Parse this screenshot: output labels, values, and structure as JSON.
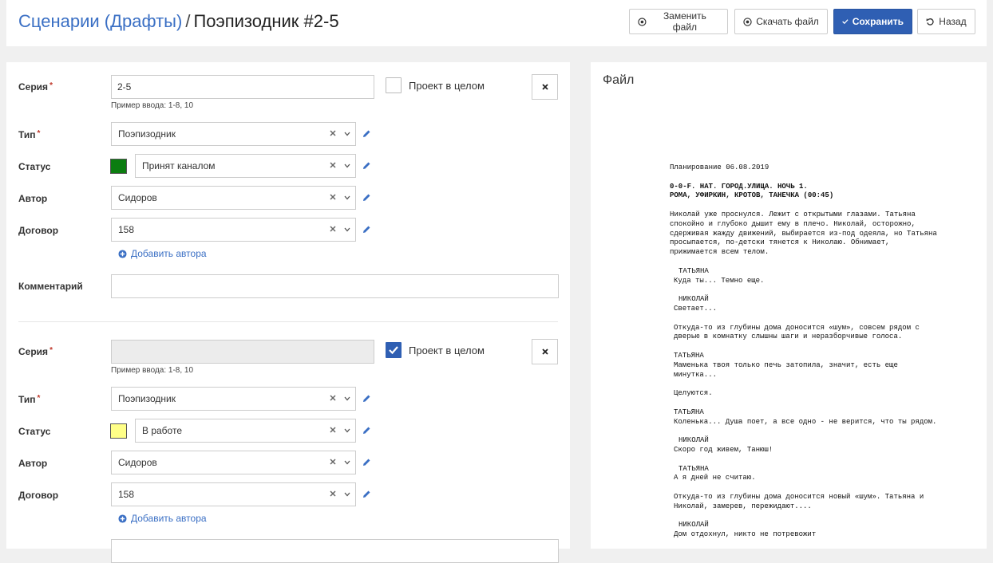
{
  "header": {
    "breadcrumb_link": "Сценарии (Драфты)",
    "separator": "/",
    "current": "Поэпизодник #2-5",
    "buttons": {
      "replace": "Заменить файл",
      "download": "Скачать файл",
      "save": "Сохранить",
      "back": "Назад"
    }
  },
  "labels": {
    "series": "Серия",
    "type": "Тип",
    "status": "Статус",
    "author": "Автор",
    "contract": "Договор",
    "comment": "Комментарий",
    "required_mark": "*",
    "project_whole": "Проект в целом",
    "hint": "Пример ввода: 1-8, 10",
    "add_author": "Добавить автора"
  },
  "blocks": [
    {
      "series_value": "2-5",
      "project_whole": false,
      "type": "Поэпизодник",
      "status": "Принят каналом",
      "status_color": "#0b7d10",
      "author": "Сидоров",
      "contract": "158",
      "comment": ""
    },
    {
      "series_value": "",
      "project_whole": true,
      "type": "Поэпизодник",
      "status": "В работе",
      "status_color": "#ffff88",
      "author": "Сидоров",
      "contract": "158"
    }
  ],
  "file_panel": {
    "title": "Файл",
    "doc": {
      "date_line": "Планирование 06.08.2019",
      "scene_heading_1": "0-0-F. НАТ. ГОРОД.УЛИЦА. НОЧЬ 1.",
      "scene_heading_2": "РОМА, УФИРКИН, КРОТОВ, ТАНЕЧКА (00:45)",
      "action_1": "Николай уже проснулся. Лежит с открытыми глазами. Татьяна спокойно и глубоко дышит ему в плечо. Николай, осторожно, сдерживая жажду движений, выбирается из-под одеяла, но Татьяна просыпается, по-детски тянется к Николаю. Обнимает, прижимается всем телом.",
      "char_1": "ТАТЬЯНА",
      "line_1": "Куда ты... Темно еще.",
      "char_2": "НИКОЛАЙ",
      "line_2": "Светает...",
      "action_2": "Откуда-то из глубины дома доносится «шум», совсем рядом с дверью в комнатку слышны шаги и неразборчивые голоса.",
      "char_3": "ТАТЬЯНА",
      "line_3": "Маменька твоя только печь затопила, значит, есть еще минутка...",
      "action_3": "Целуются.",
      "char_4": "ТАТЬЯНА",
      "line_4": "Коленька... Душа поет, а все одно - не верится, что ты рядом.",
      "char_5": "НИКОЛАЙ",
      "line_5": "Скоро год живем, Танюш!",
      "char_6": "ТАТЬЯНА",
      "line_6": "А я дней не считаю.",
      "action_4": "Откуда-то из глубины дома доносится новый «шум». Татьяна и Николай, замерев, пережидают....",
      "char_7": "НИКОЛАЙ",
      "line_7": "Дом отдохнул, никто не потревожит"
    }
  }
}
